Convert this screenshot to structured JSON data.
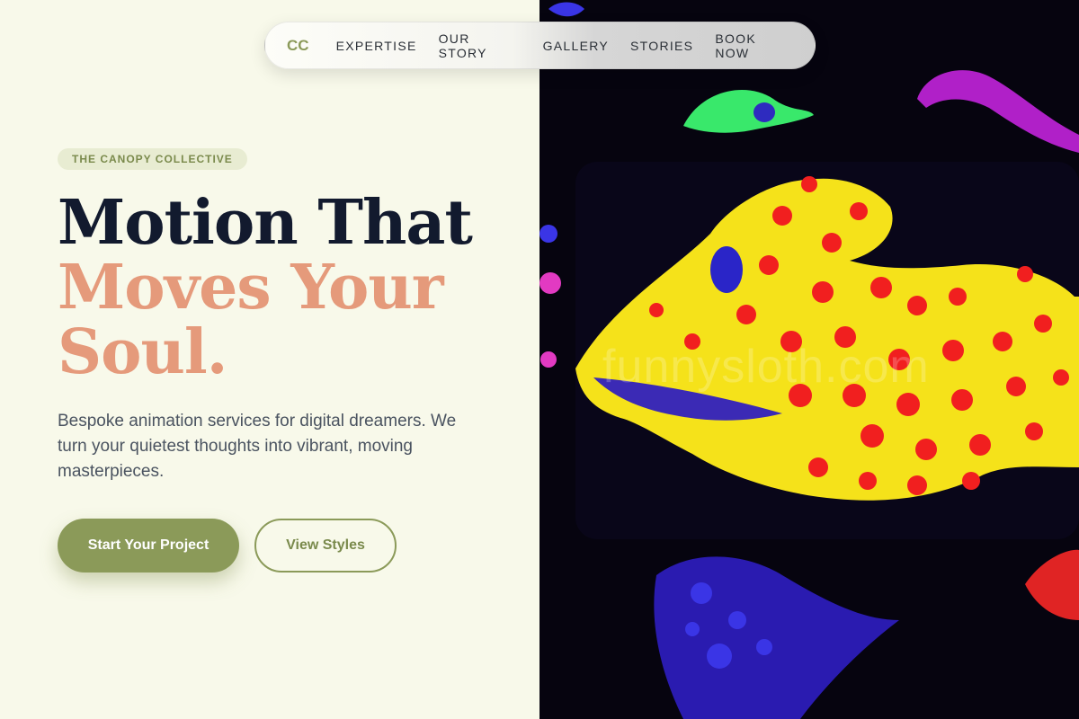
{
  "nav": {
    "logo": "CC",
    "items": [
      {
        "label": "EXPERTISE"
      },
      {
        "label": "OUR STORY"
      },
      {
        "label": "GALLERY"
      },
      {
        "label": "STORIES"
      },
      {
        "label": "BOOK NOW"
      }
    ]
  },
  "hero": {
    "badge": "THE CANOPY COLLECTIVE",
    "headline_line1": "Motion That",
    "headline_line2": "Moves Your",
    "headline_line3": "Soul.",
    "description": "Bespoke animation services for digital dreamers. We turn your quietest thoughts into vibrant, moving masterpieces.",
    "primary_button": "Start Your Project",
    "secondary_button": "View Styles"
  },
  "image": {
    "watermark": "funnysloth.com"
  },
  "colors": {
    "background": "#f8f9ea",
    "accent": "#8b9a59",
    "headline_dark": "#121a2e",
    "headline_accent": "#e59a7b"
  }
}
